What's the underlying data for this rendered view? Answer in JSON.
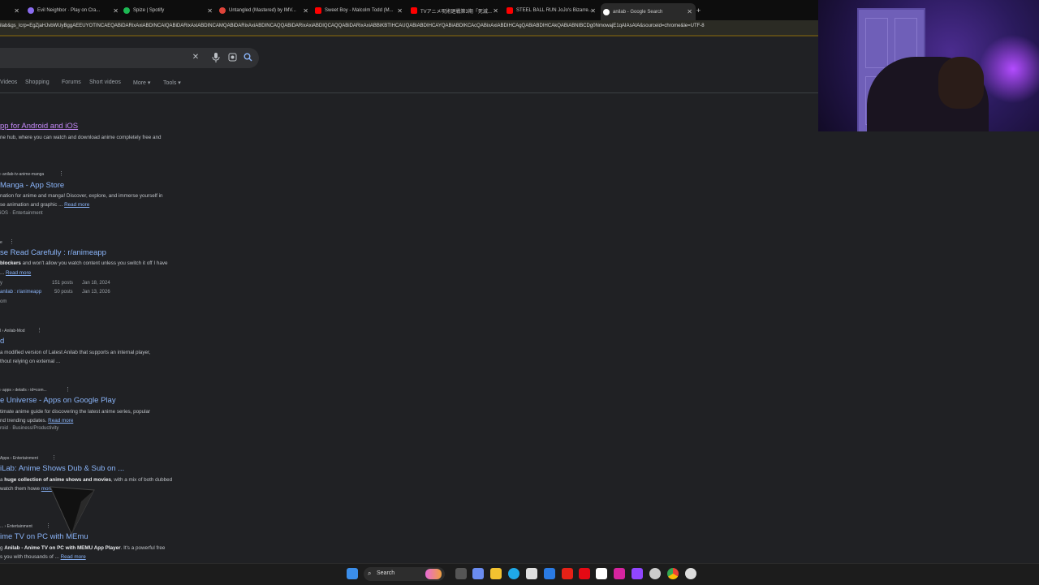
{
  "browser": {
    "tabs": [
      {
        "label": "",
        "color": "#444444"
      },
      {
        "label": "Evil Neighbor · Play on Cra...",
        "color": "#8a6cf0"
      },
      {
        "label": "Spize | Spotify",
        "color": "#1db954"
      },
      {
        "label": "Untangled (Mastered) by IMV...",
        "color": "#e0443a"
      },
      {
        "label": "Sweet Boy - Malcolm Todd (M...",
        "color": "#ff0000"
      },
      {
        "label": "TVアニメ呪術廻戦第3期「死滅...",
        "color": "#ff0000"
      },
      {
        "label": "STEEL BALL RUN JoJo's Bizarre...",
        "color": "#ff0000"
      },
      {
        "label": "anilab - Google Search",
        "color": "#ffffff"
      }
    ],
    "new_tab": "+",
    "url": "ilab&gs_lcrp=EgZjaHJvbWUyBggAEEUYOTINCAEQABiDARixAxiABDINCAIQABiDARixAxiABDINCAMQABiDARixAxiABDINCAQQABiDARixAxiABDIQCAQQABiDARixAxiABBiKBTIHCAUQABiABDIHCAYQABiABDIKCAcQABixAxiABDIHCAgQABiABDIHCAkQABiABNIBCDg0NmowajE1qAIAsAIA&sourceid=chrome&ie=UTF-8"
  },
  "search": {
    "clear_icon": "close-icon",
    "mic_icon": "mic-icon",
    "lens_icon": "lens-icon",
    "search_icon": "search-icon"
  },
  "filters": [
    "Videos",
    "Shopping",
    "Forums",
    "Short videos",
    "More ▾",
    "Tools ▾"
  ],
  "results": [
    {
      "title": "pp for Android and iOS",
      "snippet": "ne hub, where you can watch and download anime completely free and"
    },
    {
      "cite": "› anilab-tv-anime-manga",
      "title": "Manga - App Store",
      "snippet1": "nation for anime and manga! Discover, explore, and immerse yourself in",
      "snippet2": "se animation and graphic ...",
      "read_more": "Read more",
      "meta": "iOS · Entertainment"
    },
    {
      "cite": "e",
      "title": "se Read Carefully : r/animeapp",
      "snippet1_bold": "blockers",
      "snippet1": " and won't allow you watch content unless you switch it off I have",
      "read_more": "Read more",
      "sub": [
        {
          "title": "y",
          "posts": "151 posts",
          "date": "Jan 18, 2024"
        },
        {
          "title": "anilab : r/animeapp",
          "posts": "50 posts",
          "date": "Jan 13, 2026"
        }
      ],
      "meta": "om"
    },
    {
      "cite": "l › Anilab-Mod",
      "title": "d",
      "snippet1": "a modified version of Latest Anilab that supports an internal player,",
      "snippet2": "thout relying on external ..."
    },
    {
      "cite": "› apps › details › id=com...",
      "title": "e Universe - Apps on Google Play",
      "snippet1": "timate anime guide for discovering the latest anime series, popular",
      "snippet2": "nd trending updates.",
      "read_more": "Read more",
      "meta": "roid · Business/Productivity"
    },
    {
      "cite": "Apps › Entertainment",
      "title": "iLab: Anime Shows Dub & Sub on ...",
      "snippet_pre": "a ",
      "snippet_bold": "huge collection of anime shows and movies",
      "snippet1": ", with a mix of both dubbed",
      "snippet2": "watch them howe",
      "read_more": "more"
    },
    {
      "cite": "... › Entertainment",
      "title": "ime TV on PC with MEmu",
      "snippet_pre": "g ",
      "snippet_bold": "Anilab - Anime TV on PC with MEMU App Player",
      "snippet1": ". It's a powerful free",
      "snippet2": "s you with thousands of ...",
      "read_more": "Read more"
    }
  ],
  "taskbar": {
    "search_label": "Search",
    "icons": [
      {
        "name": "windows-start-icon",
        "color": "#3b8eea"
      },
      {
        "name": "copilot-icon",
        "color": "#e86ad7"
      },
      {
        "name": "task-view-icon",
        "color": "#dddddd"
      },
      {
        "name": "copilot-app-icon",
        "color": "#6a8cf0"
      },
      {
        "name": "file-explorer-icon",
        "color": "#f2c230"
      },
      {
        "name": "edge-icon",
        "color": "#1fa9e8"
      },
      {
        "name": "store-icon",
        "color": "#e0e0e0"
      },
      {
        "name": "outlook-icon",
        "color": "#2a7be4"
      },
      {
        "name": "youtube-icon",
        "color": "#e62117"
      },
      {
        "name": "netflix-icon",
        "color": "#e50914"
      },
      {
        "name": "amazon-icon",
        "color": "#ffffff"
      },
      {
        "name": "instagram-icon",
        "color": "#d6249f"
      },
      {
        "name": "twitch-icon",
        "color": "#9146ff"
      },
      {
        "name": "settings-icon",
        "color": "#cccccc"
      },
      {
        "name": "chrome-icon",
        "color": "#4caf50"
      },
      {
        "name": "roblox-icon",
        "color": "#dddddd"
      }
    ]
  }
}
